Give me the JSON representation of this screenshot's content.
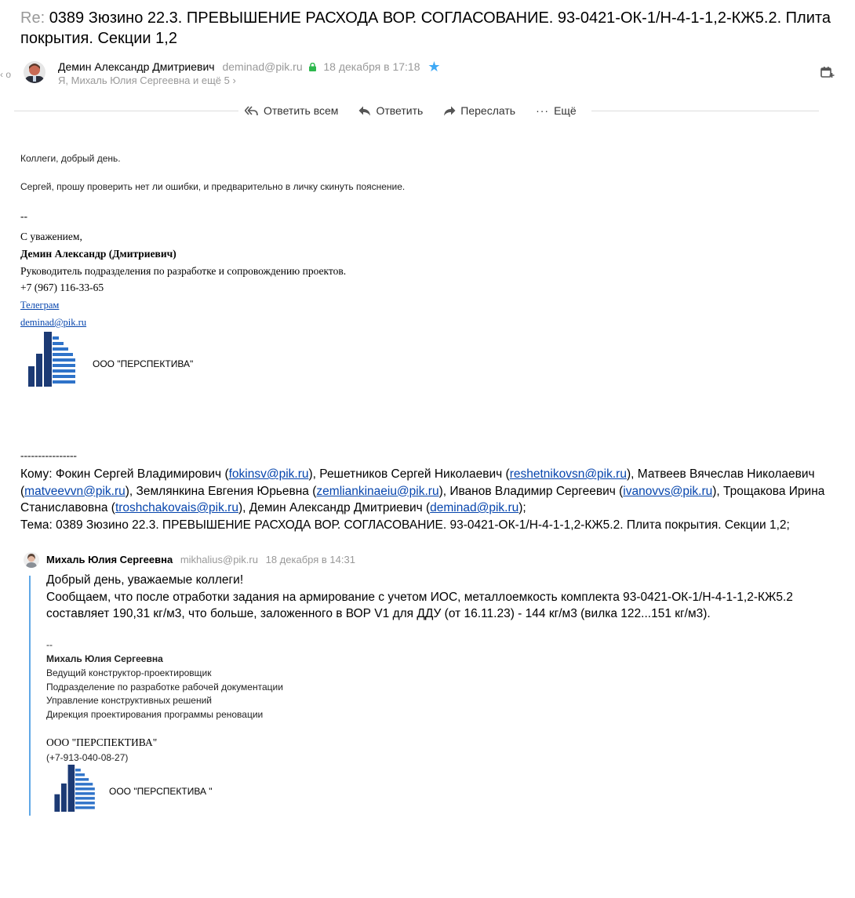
{
  "subject": {
    "prefix": "Re:",
    "text": "0389 Зюзино 22.3. ПРЕВЫШЕНИЕ РАСХОДА ВОР. СОГЛАСОВАНИЕ. 93-0421-ОК-1/Н-4-1-1,2-КЖ5.2. Плита покрытия. Секции 1,2"
  },
  "message": {
    "sender_name": "Демин Александр Дмитриевич",
    "sender_email": "deminad@pik.ru",
    "date": "18 декабря в 17:18",
    "recipients": "Я, Михаль Юлия Сергеевна и ещё 5"
  },
  "actions": {
    "reply_all": "Ответить всем",
    "reply": "Ответить",
    "forward": "Переслать",
    "more": "Ещё"
  },
  "body": {
    "greeting": "Коллеги, добрый день.",
    "text": "Сергей, прошу проверить нет ли ошибки, и предварительно в личку скинуть пояснение."
  },
  "signature": {
    "dashes": "--",
    "regards": "С уважением,",
    "name": "Демин Александр (Дмитриевич)",
    "position": "Руководитель подразделения по разработке и сопровождению проектов.",
    "phone": "+7 (967) 116-33-65",
    "telegram": "Телеграм",
    "email": "deminad@pik.ru",
    "company": "ООО \"ПЕРСПЕКТИВА\""
  },
  "original": {
    "separator": "----------------",
    "to_label": "Кому:",
    "r1_name": "Фокин Сергей Владимирович",
    "r1_email": "fokinsv@pik.ru",
    "r2_name": "Решетников Сергей Николаевич",
    "r2_email": "reshetnikovsn@pik.ru",
    "r3_name": "Матвеев Вячеслав Николаевич",
    "r3_email": "matveevvn@pik.ru",
    "r4_name": "Землянкина Евгения Юрьевна",
    "r4_email": "zemliankinaeiu@pik.ru",
    "r5_name": "Иванов Владимир Сергеевич",
    "r5_email": "ivanovvs@pik.ru",
    "r6_name": "Трощакова Ирина Станиславовна",
    "r6_email": "troshchakovais@pik.ru",
    "r7_name": "Демин Александр Дмитриевич",
    "r7_email": "deminad@pik.ru",
    "topic_label": "Тема:",
    "topic": "0389 Зюзино 22.3. ПРЕВЫШЕНИЕ РАСХОДА ВОР. СОГЛАСОВАНИЕ. 93-0421-ОК-1/Н-4-1-1,2-КЖ5.2. Плита покрытия. Секции 1,2;"
  },
  "quoted": {
    "sender_name": "Михаль Юлия Сергеевна",
    "sender_email": "mikhalius@pik.ru",
    "date": "18 декабря в 14:31",
    "greeting": "Добрый день, уважаемые коллеги!",
    "text": "Сообщаем, что после отработки задания на армирование с учетом ИОС, металлоемкость комплекта 93-0421-ОК-1/Н-4-1-1,2-КЖ5.2 составляет 190,31 кг/м3, что больше, заложенного в ВОР V1 для ДДУ (от 16.11.23)  - 144 кг/м3 (вилка 122...151 кг/м3).",
    "sig_dashes": "--",
    "sig_name": "Михаль Юлия Сергеевна",
    "sig_line1": "Ведущий конструктор-проектировщик",
    "sig_line2": "Подразделение по разработке рабочей документации",
    "sig_line3": "Управление конструктивных решений",
    "sig_line4": "Дирекция проектирования программы реновации",
    "sig_company": "ООО \"ПЕРСПЕКТИВА\"",
    "sig_phone": "(+7-913-040-08-27)",
    "logo_text": "ООО \"ПЕРСПЕКТИВА \""
  },
  "colors": {
    "accent": "#3fa9f5",
    "link": "#0645ad",
    "quote_bar": "#5fa8e6",
    "logo_dark": "#1c3a74",
    "logo_blue": "#2f73c9"
  }
}
